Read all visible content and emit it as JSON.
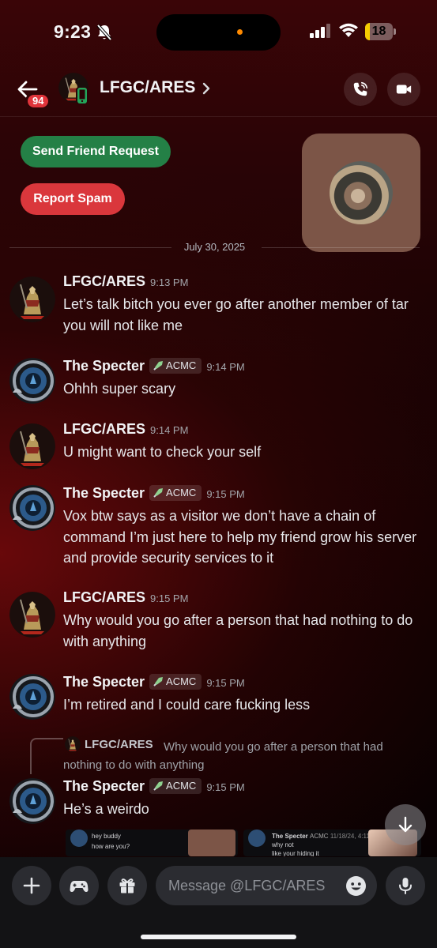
{
  "status_bar": {
    "time": "9:23",
    "battery_level": "18",
    "battery_fraction": 0.18
  },
  "header": {
    "title": "LFGC/ARES",
    "unread_count": "94",
    "icons": [
      "back-arrow-icon",
      "chevron-right-icon",
      "phone-call-icon",
      "video-camera-icon"
    ]
  },
  "actions": {
    "send_friend_request": "Send Friend Request",
    "report_spam": "Report Spam"
  },
  "divider": {
    "date": "July 30, 2025"
  },
  "messages": [
    {
      "author": "LFGC/ARES",
      "tag": "",
      "time": "9:13 PM",
      "text": "Let’s talk bitch you ever go after another member of tar you will not like me"
    },
    {
      "author": "The Specter",
      "tag": "ACMC",
      "time": "9:14 PM",
      "text": "Ohhh super scary"
    },
    {
      "author": "LFGC/ARES",
      "tag": "",
      "time": "9:14 PM",
      "text": "U might want to check your self"
    },
    {
      "author": "The Specter",
      "tag": "ACMC",
      "time": "9:15 PM",
      "text": "Vox btw says as a visitor we don’t have a chain of command I’m just here to help my friend grow his server and provide security services to it"
    },
    {
      "author": "LFGC/ARES",
      "tag": "",
      "time": "9:15 PM",
      "text": "Why would you go after a person that had nothing to do with anything"
    },
    {
      "author": "The Specter",
      "tag": "ACMC",
      "time": "9:15 PM",
      "text": "I’m retired and I could care fucking less"
    },
    {
      "author": "The Specter",
      "tag": "ACMC",
      "time": "9:15 PM",
      "text": "He’s a weirdo"
    }
  ],
  "reply": {
    "author": "LFGC/ARES",
    "text": "Why would you go after a person that had nothing to do with anything"
  },
  "preview": {
    "card1_line1": "hey buddy",
    "card1_line2": "how are you?",
    "card2_author": "The Specter",
    "card2_tag": "ACMC",
    "card2_time": "11/18/24, 4:11 PM",
    "card2_line1": "why not",
    "card2_line2": "like your hiding it"
  },
  "composer": {
    "placeholder": "Message @LFGC/ARES",
    "icons": [
      "plus-icon",
      "gamepad-icon",
      "gift-icon",
      "emoji-icon",
      "microphone-icon"
    ]
  },
  "colors": {
    "green": "#248046",
    "red": "#da373c",
    "badge": "#e0343b"
  }
}
